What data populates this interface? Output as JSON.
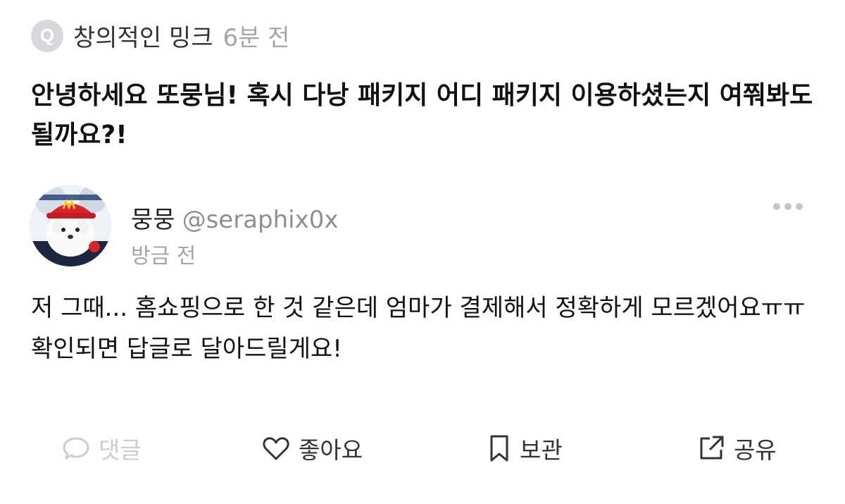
{
  "question": {
    "badge": "Q",
    "author": "창의적인 밍크",
    "time": "6분 전",
    "text": "안녕하세요 또뭉님! 혹시 다낭 패키지 어디 패키지 이용하셨는지 여쭤봐도 될까요?!"
  },
  "answer": {
    "name": "뭉뭉",
    "handle": "@seraphix0x",
    "time": "방금 전",
    "text": "저 그때... 홈쇼핑으로 한 것 같은데 엄마가 결제해서 정확하게 모르겠어요ㅠㅠ 확인되면 답글로 달아드릴게요!"
  },
  "actions": {
    "comment": "댓글",
    "like": "좋아요",
    "save": "보관",
    "share": "공유"
  },
  "icons": {
    "comment": "speech-bubble-icon",
    "like": "heart-icon",
    "save": "bookmark-icon",
    "share": "share-out-icon",
    "more": "more-dots-icon"
  },
  "colors": {
    "muted": "#a2a6ab",
    "disabled": "#c9ccd0",
    "text": "#111111"
  }
}
